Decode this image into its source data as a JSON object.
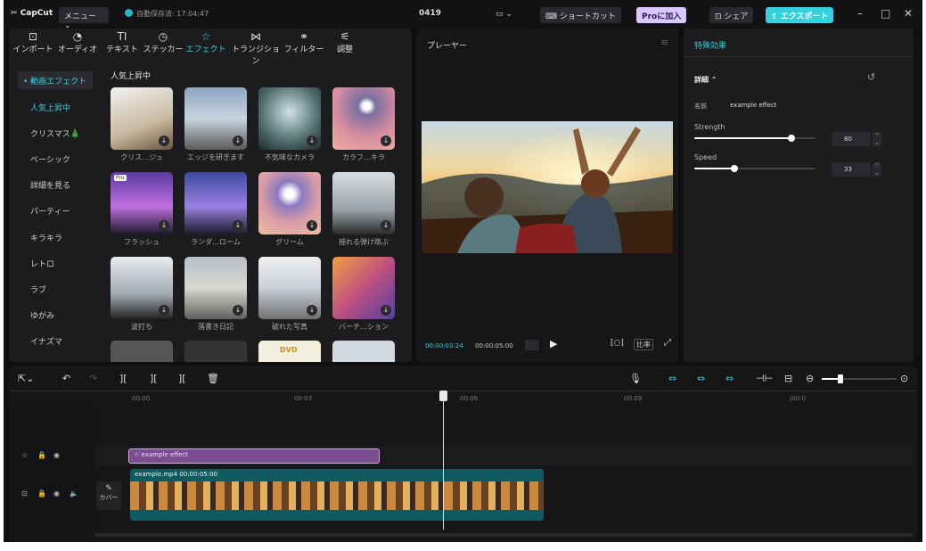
{
  "titlebar": {
    "logo": "CapCut",
    "menu_label": "メニュー",
    "autosave_text": "自動保存済: 17:04:47",
    "project_name": "0419",
    "layout_label": "▭",
    "shortcut_label": "ショートカット",
    "pro_label": "Proに加入",
    "share_label": "シェア",
    "export_label": "エクスポート",
    "accent_color": "#35d0dc"
  },
  "toolbar": {
    "tabs": [
      {
        "label": "インポート",
        "icon": "import-icon"
      },
      {
        "label": "オーディオ",
        "icon": "audio-icon"
      },
      {
        "label": "テキスト",
        "icon": "text-icon"
      },
      {
        "label": "ステッカー",
        "icon": "sticker-icon"
      },
      {
        "label": "エフェクト",
        "icon": "effects-icon",
        "active": true
      },
      {
        "label": "トランジション",
        "icon": "transition-icon"
      },
      {
        "label": "フィルター",
        "icon": "filter-icon"
      },
      {
        "label": "調整",
        "icon": "adjust-icon"
      }
    ]
  },
  "sidebar": {
    "header": "• 動画エフェクト",
    "items": [
      "人気上昇中",
      "クリスマス🎄",
      "ベーシック",
      "詳細を見る",
      "パーティー",
      "キラキラ",
      "レトロ",
      "ラブ",
      "ゆがみ",
      "イナズマ"
    ]
  },
  "library": {
    "section_title": "人気上昇中",
    "effects": [
      {
        "label": "クリス…ジュ"
      },
      {
        "label": "エッジを研ぎます"
      },
      {
        "label": "不気味なカメラ"
      },
      {
        "label": "カラフ…キラ"
      },
      {
        "label": "フラッシュ",
        "badge": "Pro"
      },
      {
        "label": "ランダ…ローム"
      },
      {
        "label": "グリーム"
      },
      {
        "label": "揺れる弾け跳ぶ"
      },
      {
        "label": "波打ち"
      },
      {
        "label": "落書き日記"
      },
      {
        "label": "破れた写真"
      },
      {
        "label": "バーチ…ション"
      }
    ]
  },
  "player": {
    "title": "プレーヤー",
    "current_time": "00:00:03:24",
    "total_time": "00:00:05:00",
    "ratio_label": "比率"
  },
  "effect_panel": {
    "title": "特殊効果",
    "section": "詳細 ⌃",
    "name_label": "名前",
    "name_value": "example effect",
    "strength_label": "Strength",
    "strength_value": "80",
    "strength_level": 0.8,
    "speed_label": "Speed",
    "speed_value": "33",
    "speed_level": 0.33
  },
  "timeline": {
    "ruler": [
      "00:00",
      "00:03",
      "00:06",
      "00:09"
    ],
    "effect_clip_label": "example effect",
    "video_clip_label": "example.mp4  00:00:05:00",
    "cover_label": "カバー"
  }
}
